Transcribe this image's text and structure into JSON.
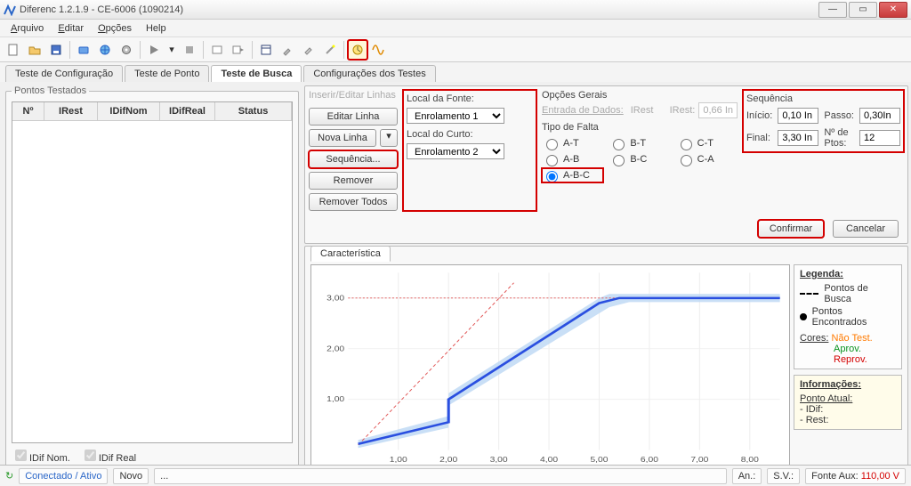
{
  "window": {
    "title": "Diferenc 1.2.1.9 - CE-6006 (1090214)"
  },
  "menus": {
    "arquivo": "Arquivo",
    "editar": "Editar",
    "opcoes": "Opções",
    "help": "Help"
  },
  "toolbar": {
    "icons": [
      "new",
      "open",
      "save",
      "hard",
      "globe",
      "config",
      "play",
      "dropdown",
      "stop",
      "record",
      "recplay",
      "pane",
      "brush",
      "paint",
      "wand",
      "clock",
      "wave"
    ]
  },
  "tabs": {
    "config": "Teste de Configuração",
    "ponto": "Teste de Ponto",
    "busca": "Teste de Busca",
    "conftestes": "Configurações dos Testes"
  },
  "tested": {
    "group": "Pontos Testados",
    "cols": {
      "n": "Nº",
      "irest": "IRest",
      "idifnom": "IDifNom",
      "idifreal": "IDifReal",
      "status": "Status"
    },
    "chk_nom": "IDif Nom.",
    "chk_real": "IDif Real"
  },
  "form": {
    "inserir": "Inserir/Editar Linhas",
    "opcoes": "Opções Gerais",
    "entrada": "Entrada de Dados:",
    "entrada_val": "IRest",
    "irest_lbl": "IRest:",
    "irest_val": "0,66 In",
    "btn_editar": "Editar Linha",
    "btn_nova": "Nova Linha",
    "btn_seq": "Sequência...",
    "btn_rem": "Remover",
    "btn_rem_all": "Remover Todos",
    "local_fonte_lbl": "Local da Fonte:",
    "local_fonte_val": "Enrolamento 1",
    "local_curto_lbl": "Local do Curto:",
    "local_curto_val": "Enrolamento 2",
    "tipo_falta": "Tipo de Falta",
    "faltas": {
      "at": "A-T",
      "bt": "B-T",
      "ct": "C-T",
      "ab": "A-B",
      "bc": "B-C",
      "ca": "C-A",
      "abc": "A-B-C"
    },
    "seq_title": "Sequência",
    "inicio_lbl": "Início:",
    "inicio_val": "0,10 In",
    "passo_lbl": "Passo:",
    "passo_val": "0,30In",
    "final_lbl": "Final:",
    "final_val": "3,30 In",
    "nptos_lbl": "Nº de Ptos:",
    "nptos_val": "12",
    "confirmar": "Confirmar",
    "cancelar": "Cancelar"
  },
  "chart_tab": "Característica",
  "legend": {
    "title": "Legenda:",
    "busca": "Pontos de Busca",
    "found": "Pontos Encontrados",
    "cores": "Cores:",
    "nao": "Não Test.",
    "aprov": "Aprov.",
    "reprov": "Reprov.",
    "info": "Informações:",
    "patual": "Ponto Atual:",
    "idif": "- IDif:",
    "rest": "- Rest:"
  },
  "chart_data": {
    "type": "line",
    "xlabel": "",
    "ylabel": "",
    "xlim": [
      0,
      8.6
    ],
    "ylim": [
      0,
      3.5
    ],
    "xticks": [
      1.0,
      2.0,
      3.0,
      4.0,
      5.0,
      6.0,
      7.0,
      8.0
    ],
    "yticks": [
      1.0,
      2.0,
      3.0
    ],
    "series": [
      {
        "name": "diag",
        "style": "red-dash",
        "points": [
          [
            0.2,
            0.1
          ],
          [
            3.3,
            3.3
          ]
        ]
      },
      {
        "name": "h3",
        "style": "red-dot",
        "points": [
          [
            0,
            3.0
          ],
          [
            8.6,
            3.0
          ]
        ]
      },
      {
        "name": "char-main",
        "style": "blue-thick",
        "points": [
          [
            0.2,
            0.12
          ],
          [
            2.0,
            0.55
          ],
          [
            2.0,
            1.0
          ],
          [
            5.0,
            2.9
          ],
          [
            5.4,
            3.0
          ],
          [
            8.6,
            3.0
          ]
        ]
      },
      {
        "name": "char-band-top",
        "style": "blue-band",
        "points": [
          [
            0.2,
            0.2
          ],
          [
            2.0,
            0.67
          ],
          [
            2.0,
            1.12
          ],
          [
            5.0,
            3.0
          ],
          [
            5.2,
            3.08
          ],
          [
            8.6,
            3.08
          ]
        ]
      },
      {
        "name": "char-band-bot",
        "style": "blue-band",
        "points": [
          [
            0.2,
            0.04
          ],
          [
            2.0,
            0.44
          ],
          [
            2.0,
            0.88
          ],
          [
            5.2,
            2.82
          ],
          [
            5.6,
            2.92
          ],
          [
            8.6,
            2.92
          ]
        ]
      }
    ]
  },
  "status": {
    "con": "Conectado / Ativo",
    "novo": "Novo",
    "dots": "...",
    "an": "An.:",
    "sv": "S.V.:",
    "fonte": "Fonte Aux:",
    "fonte_val": "110,00 V"
  }
}
